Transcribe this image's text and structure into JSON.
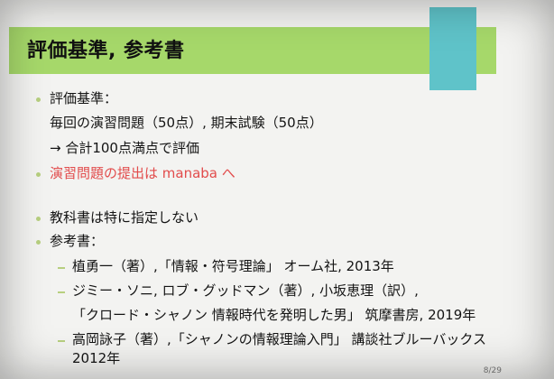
{
  "slide": {
    "title": "評価基準, 参考書",
    "items": [
      {
        "text": "評価基準："
      },
      {
        "text": "毎回の演習問題（50点）, 期末試験（50点）"
      },
      {
        "text": "→ 合計100点満点で評価"
      },
      {
        "text": "演習問題の提出は manaba へ"
      },
      {
        "text": "教科書は特に指定しない"
      },
      {
        "text": "参考書："
      },
      {
        "text": "植勇一（著）,「情報・符号理論」 オーム社, 2013年"
      },
      {
        "text": "ジミー・ソニ, ロブ・グッドマン（著）, 小坂恵理（訳）,"
      },
      {
        "text": "「クロード・シャノン 情報時代を発明した男」 筑摩書房, 2019年"
      },
      {
        "text": "高岡詠子（著）,「シャノンの情報理論入門」 講談社ブルーバックス"
      },
      {
        "text": "2012年"
      }
    ],
    "page_number": "8/29"
  }
}
